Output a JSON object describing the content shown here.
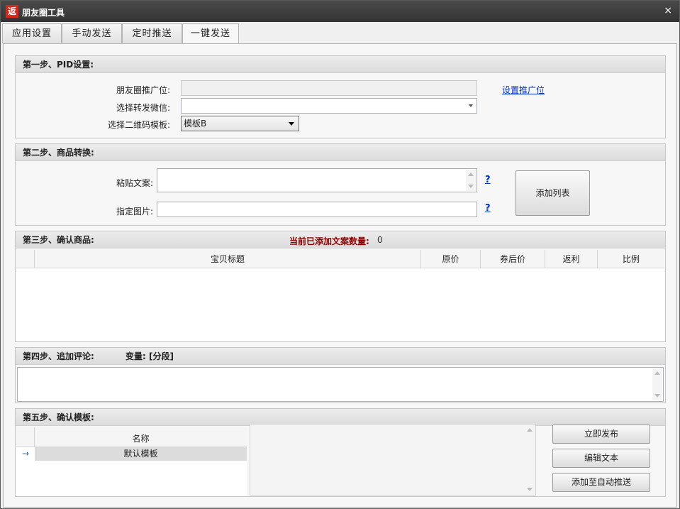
{
  "window": {
    "title": "朋友圈工具",
    "icon_text": "返",
    "close_label": "×"
  },
  "tabs": [
    {
      "label": "应用设置"
    },
    {
      "label": "手动发送"
    },
    {
      "label": "定时推送"
    },
    {
      "label": "一键发送"
    }
  ],
  "active_tab": "一键发送",
  "step1": {
    "title": "第一步、PID设置:",
    "pid_label": "朋友圈推广位:",
    "pid_value": "",
    "wechat_label": "选择转发微信:",
    "wechat_value": "",
    "qr_label": "选择二维码模板:",
    "qr_selected": "模板B",
    "set_link": "设置推广位"
  },
  "step2": {
    "title": "第二步、商品转换:",
    "paste_label": "粘贴文案:",
    "paste_value": "",
    "image_label": "指定图片:",
    "image_value": "",
    "help_mark": "?",
    "add_button": "添加列表"
  },
  "step3": {
    "title": "第三步、确认商品:",
    "count_label": "当前已添加文案数量:",
    "count_value": "0",
    "columns": [
      "宝贝标题",
      "原价",
      "券后价",
      "返利",
      "比例"
    ]
  },
  "step4": {
    "title": "第四步、追加评论:",
    "variable_label": "变量: [分段]",
    "comment_value": ""
  },
  "step5": {
    "title": "第五步、确认模板:",
    "column_name": "名称",
    "rows": [
      {
        "marker": "→",
        "name": "默认模板"
      }
    ],
    "publish_button": "立即发布",
    "edit_button": "编辑文本",
    "auto_button": "添加至自动推送"
  }
}
